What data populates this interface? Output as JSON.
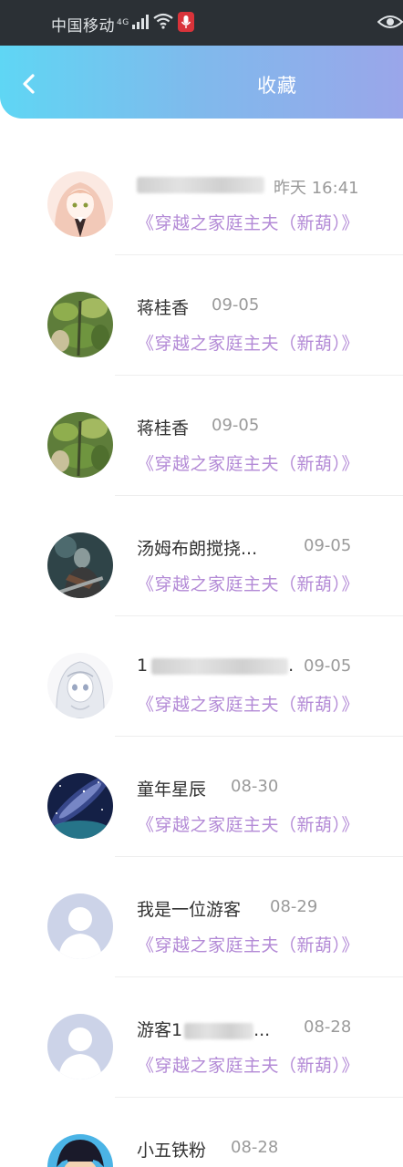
{
  "status_bar": {
    "carrier": "中国移动",
    "network": "4G"
  },
  "header": {
    "title": "收藏"
  },
  "items": [
    {
      "user": "",
      "date": "昨天 16:41",
      "book": "《穿越之家庭主夫（新葫）》",
      "avatar": "anime-girl"
    },
    {
      "user": "蒋桂香",
      "date": "09-05",
      "book": "《穿越之家庭主夫（新葫）》",
      "avatar": "plant"
    },
    {
      "user": "蒋桂香",
      "date": "09-05",
      "book": "《穿越之家庭主夫（新葫）》",
      "avatar": "plant"
    },
    {
      "user": "汤姆布朗搅挠...",
      "date": "09-05",
      "book": "《穿越之家庭主夫（新葫）》",
      "avatar": "warrior"
    },
    {
      "user": "1",
      "date": "09-05",
      "book": "《穿越之家庭主夫（新葫）》",
      "avatar": "anime-sketch"
    },
    {
      "user": "童年星辰",
      "date": "08-30",
      "book": "《穿越之家庭主夫（新葫）》",
      "avatar": "galaxy"
    },
    {
      "user": "我是一位游客",
      "date": "08-29",
      "book": "《穿越之家庭主夫（新葫）》",
      "avatar": "default-person"
    },
    {
      "user": "游客1",
      "date": "08-28",
      "book": "《穿越之家庭主夫（新葫）》",
      "avatar": "default-person"
    },
    {
      "user": "小五铁粉",
      "date": "08-28",
      "book": "",
      "avatar": "cartoon"
    }
  ],
  "colors": {
    "accent_purple": "#b38ad6",
    "header_start": "#5fd6f4",
    "header_end": "#9aa6ea"
  }
}
